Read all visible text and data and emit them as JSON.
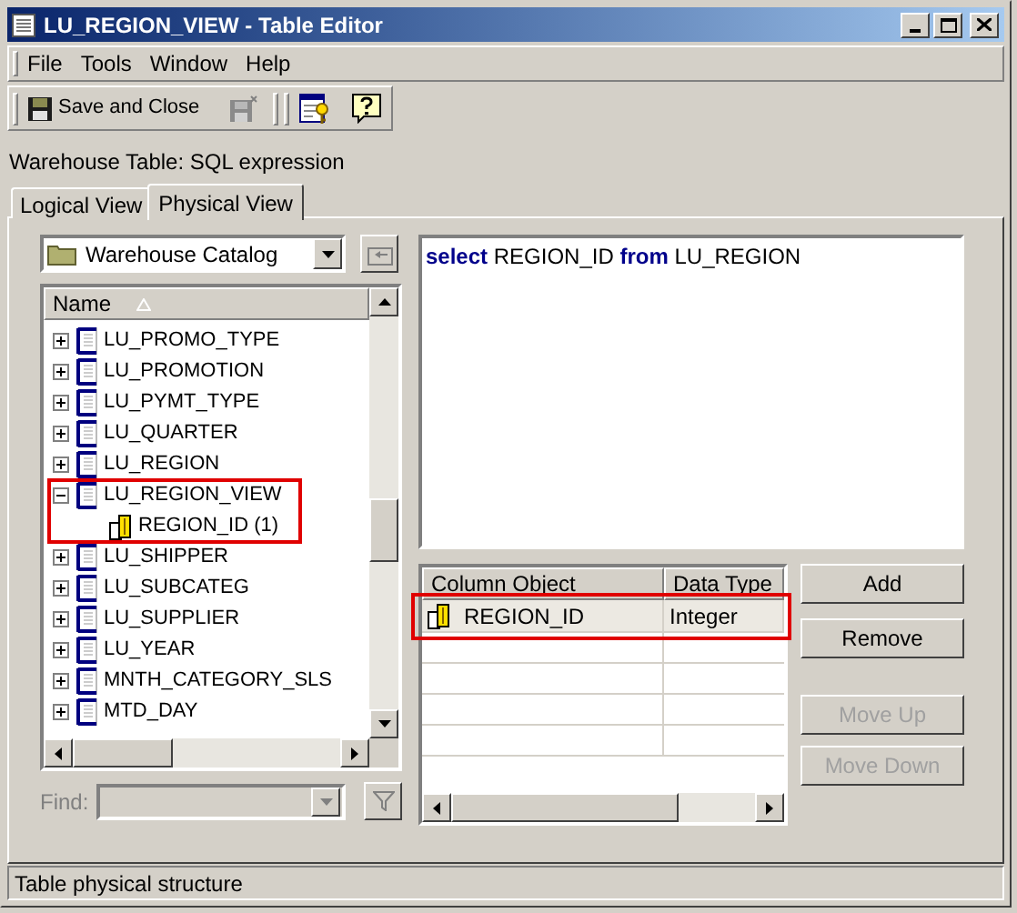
{
  "window": {
    "title": "LU_REGION_VIEW - Table Editor"
  },
  "menu": [
    "File",
    "Tools",
    "Window",
    "Help"
  ],
  "toolbar": {
    "save_close": "Save and Close"
  },
  "subtitle": "Warehouse Table: SQL expression",
  "tabs": [
    {
      "label": "Logical View",
      "selected": false
    },
    {
      "label": "Physical View",
      "selected": true
    }
  ],
  "catalog": {
    "value": "Warehouse Catalog"
  },
  "tree": {
    "column": "Name",
    "items": [
      {
        "label": "LU_PROMO_TYPE",
        "expanded": false,
        "highlighted": false
      },
      {
        "label": "LU_PROMOTION",
        "expanded": false,
        "highlighted": false
      },
      {
        "label": "LU_PYMT_TYPE",
        "expanded": false,
        "highlighted": false
      },
      {
        "label": "LU_QUARTER",
        "expanded": false,
        "highlighted": false
      },
      {
        "label": "LU_REGION",
        "expanded": false,
        "highlighted": false
      },
      {
        "label": "LU_REGION_VIEW",
        "expanded": true,
        "highlighted": true,
        "children": [
          {
            "label": "REGION_ID (1)"
          }
        ]
      },
      {
        "label": "LU_SHIPPER",
        "expanded": false,
        "highlighted": false
      },
      {
        "label": "LU_SUBCATEG",
        "expanded": false,
        "highlighted": false
      },
      {
        "label": "LU_SUPPLIER",
        "expanded": false,
        "highlighted": false
      },
      {
        "label": "LU_YEAR",
        "expanded": false,
        "highlighted": false
      },
      {
        "label": "MNTH_CATEGORY_SLS",
        "expanded": false,
        "highlighted": false
      },
      {
        "label": "MTD_DAY",
        "expanded": false,
        "highlighted": false
      }
    ]
  },
  "find": {
    "label": "Find:",
    "disabled": true
  },
  "sql": "**select** REGION_ID **from** LU_REGION",
  "columns_table": {
    "columns": [
      "Column Object",
      "Data Type"
    ],
    "rows": [
      {
        "cells": [
          "REGION_ID",
          "Integer"
        ],
        "highlighted": true
      }
    ]
  },
  "buttons": [
    {
      "label": "Add",
      "disabled": false
    },
    {
      "label": "Remove",
      "disabled": false
    },
    {
      "label": "Move Up",
      "disabled": true
    },
    {
      "label": "Move Down",
      "disabled": true
    }
  ],
  "status_bar": "Table physical structure"
}
